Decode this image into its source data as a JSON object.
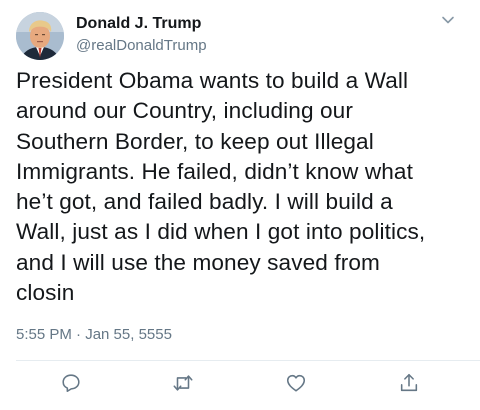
{
  "author": {
    "name": "Donald J. Trump",
    "handle": "@realDonaldTrump"
  },
  "tweet": {
    "text": "President Obama wants to build a Wall\naround our Country, including our\nSouthern Border, to keep out Illegal\nImmigrants. He failed, didn’t know what\nhe’t got, and failed badly. I will build a\nWall, just as I did when I got into politics,\nand I will use the money saved from\nclosin",
    "timestamp": "5:55 PM · Jan 55, 5555"
  },
  "icons": {
    "menu": "chevron-down-icon",
    "reply": "reply-icon",
    "retweet": "retweet-icon",
    "like": "like-icon",
    "share": "share-icon"
  },
  "colors": {
    "text": "#14171a",
    "secondary": "#657786",
    "divider": "#e6ecf0"
  }
}
